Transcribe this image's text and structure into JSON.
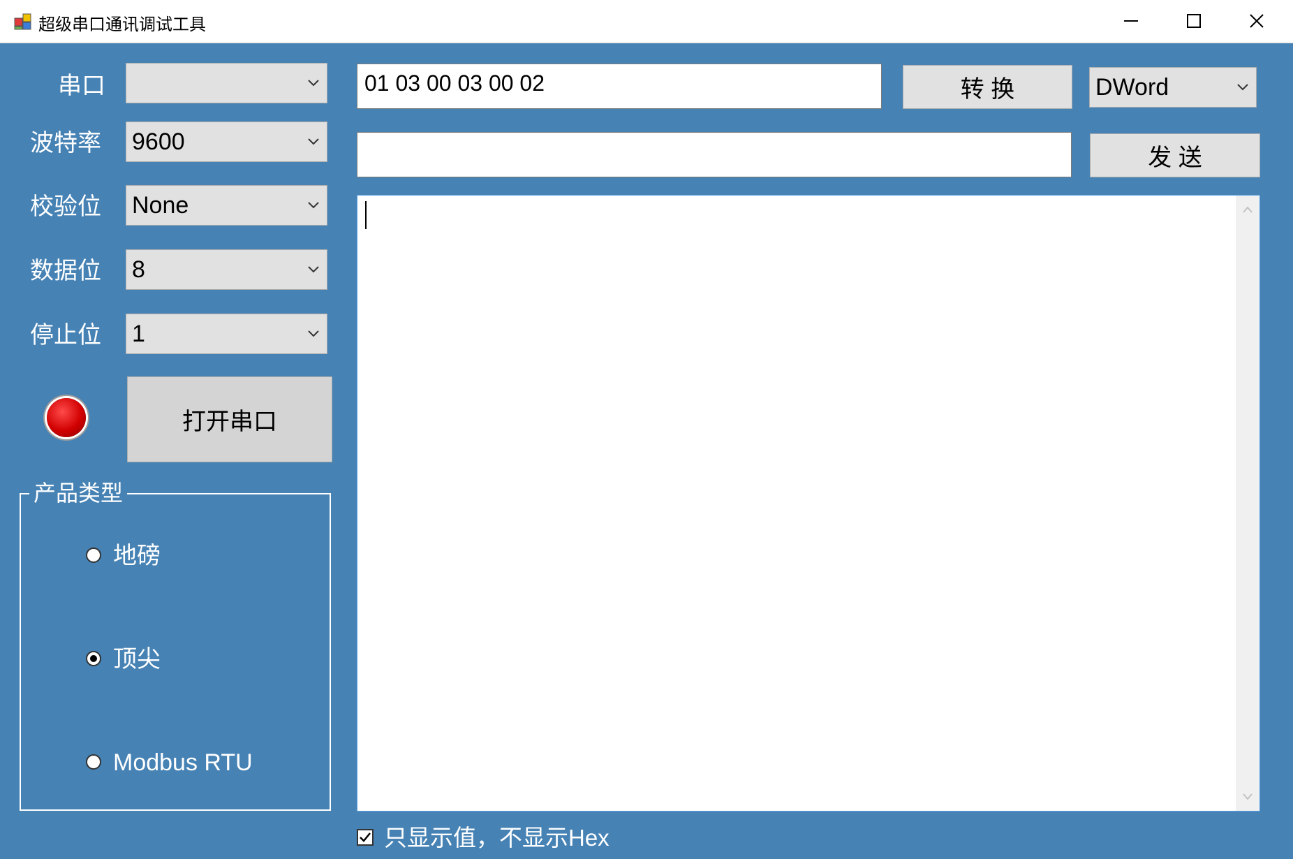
{
  "window": {
    "title": "超级串口通讯调试工具",
    "icon": "app-icon",
    "controls": [
      "minimize-icon",
      "maximize-icon",
      "close-icon"
    ]
  },
  "serial": {
    "port_label": "串口",
    "port_value": "",
    "baud_label": "波特率",
    "baud_value": "9600",
    "parity_label": "校验位",
    "parity_value": "None",
    "databits_label": "数据位",
    "databits_value": "8",
    "stopbits_label": "停止位",
    "stopbits_value": "1",
    "open_button": "打开串口",
    "status_led_color": "#d10000"
  },
  "product": {
    "group_title": "产品类型",
    "options": [
      "地磅",
      "顶尖",
      "Modbus RTU"
    ],
    "selected": "顶尖"
  },
  "command": {
    "input_value": "01 03 00 03 00 02",
    "convert_button": "转 换",
    "type_value": "DWord",
    "send_input_value": "",
    "send_button": "发 送"
  },
  "output": {
    "text": ""
  },
  "options": {
    "value_only_label": "只显示值，不显示Hex",
    "value_only_checked": true
  },
  "colors": {
    "background": "#4682b4",
    "control": "#e1e1e1",
    "output_border": "#569de5"
  }
}
